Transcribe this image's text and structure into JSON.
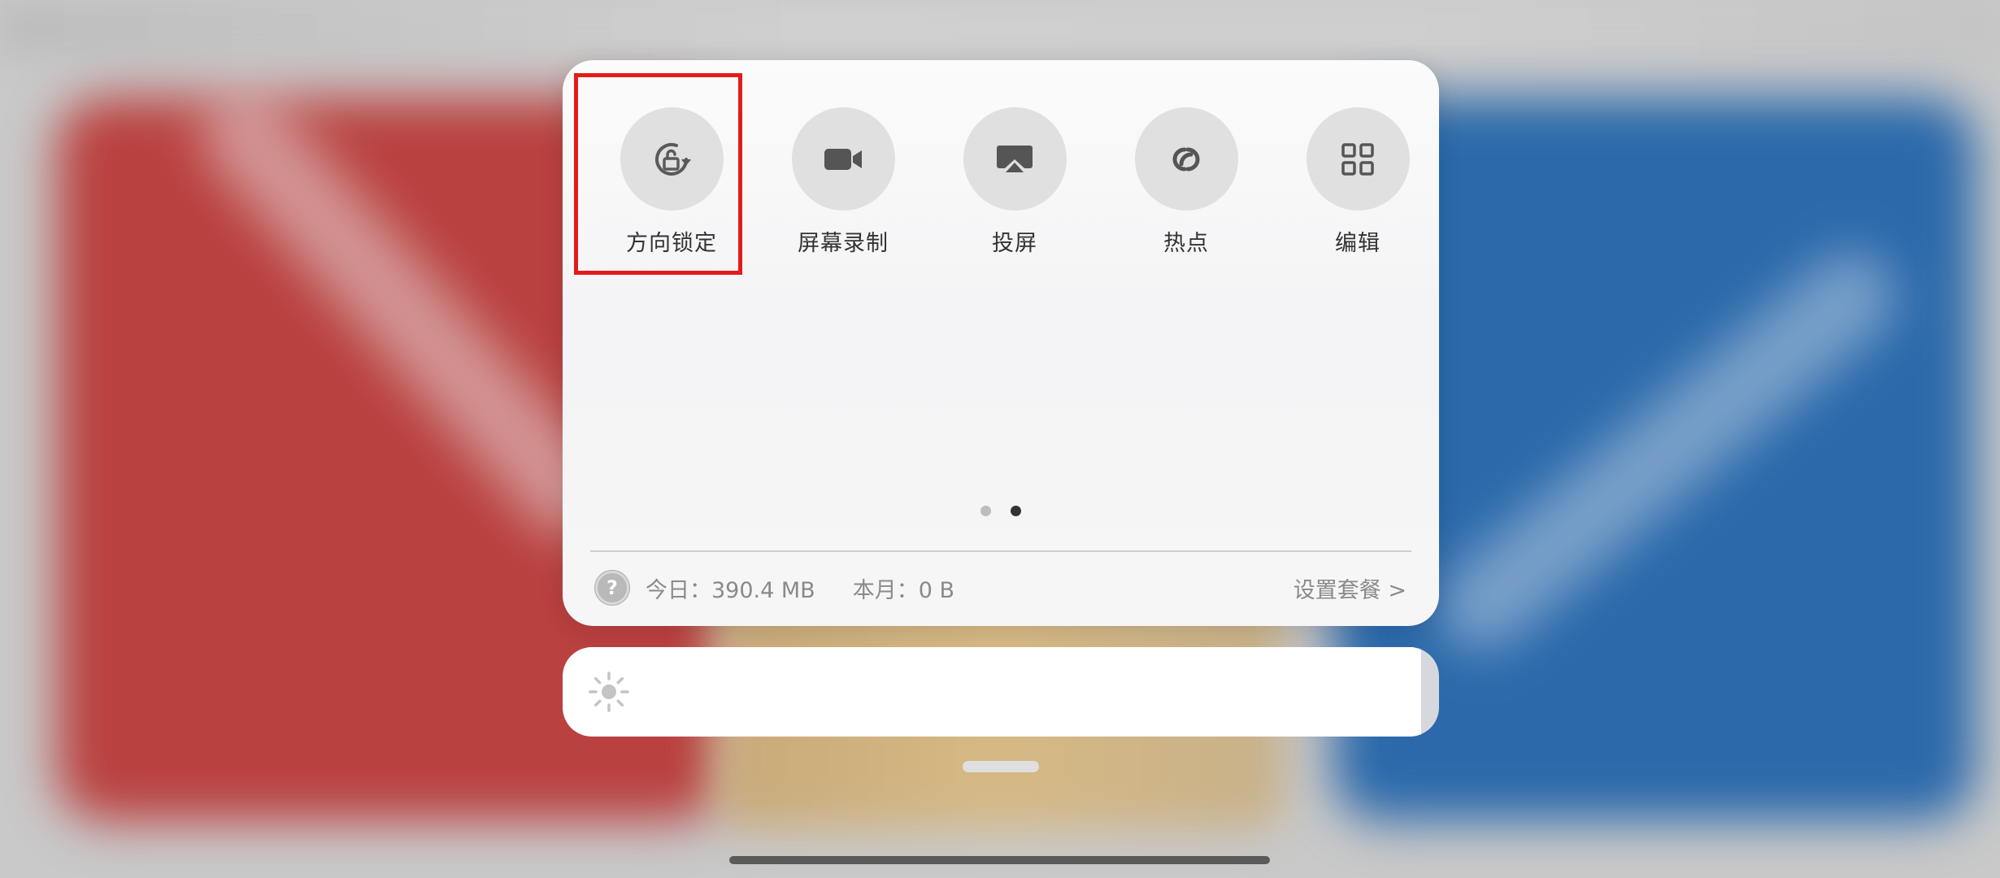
{
  "control_center": {
    "tiles": [
      {
        "label": "方向锁定",
        "icon": "rotation-lock-icon"
      },
      {
        "label": "屏幕录制",
        "icon": "video-camera-icon"
      },
      {
        "label": "投屏",
        "icon": "screen-cast-icon"
      },
      {
        "label": "热点",
        "icon": "hotspot-link-icon"
      },
      {
        "label": "编辑",
        "icon": "grid-edit-icon"
      }
    ],
    "pagination": {
      "total_pages": 2,
      "current_page": 2
    },
    "data_usage": {
      "today": "今日：390.4 MB",
      "month": "本月：0 B",
      "plan_link": "设置套餐 >"
    },
    "help_icon_glyph": "?"
  },
  "brightness": {
    "level": 0.98,
    "icon": "sun-icon"
  },
  "colors": {
    "highlight_border": "#e31b1b",
    "tile_background": "#e0e0e0",
    "wallpaper_red": "#b9413f",
    "wallpaper_blue": "#2b69aa"
  }
}
